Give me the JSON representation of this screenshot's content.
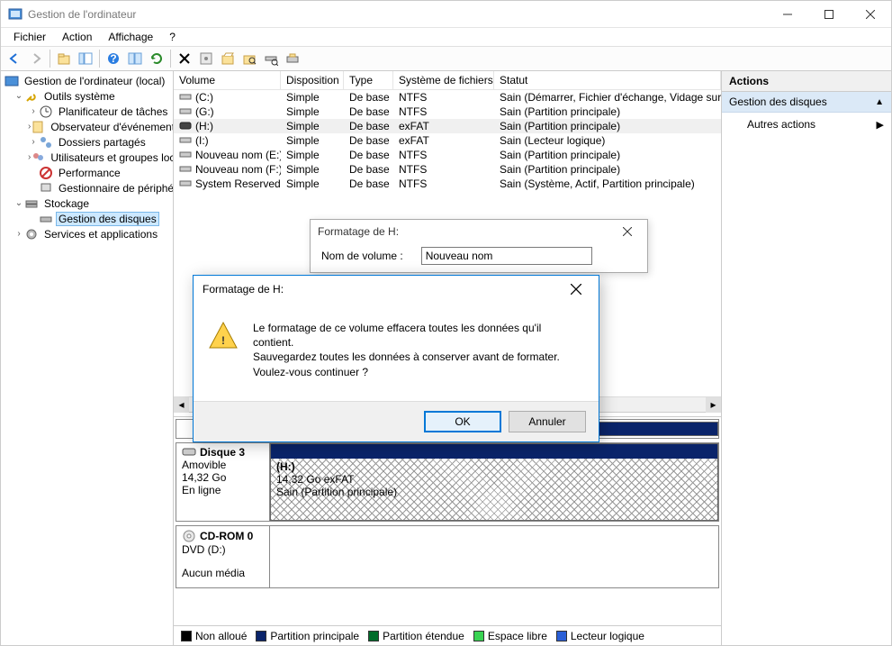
{
  "window": {
    "title": "Gestion de l'ordinateur"
  },
  "menu": {
    "file": "Fichier",
    "action": "Action",
    "view": "Affichage",
    "help": "?"
  },
  "tree": {
    "root": "Gestion de l'ordinateur (local)",
    "system_tools": "Outils système",
    "task_scheduler": "Planificateur de tâches",
    "event_viewer": "Observateur d'événements",
    "shared_folders": "Dossiers partagés",
    "users_groups": "Utilisateurs et groupes locaux",
    "performance": "Performance",
    "device_manager": "Gestionnaire de périphériques",
    "storage": "Stockage",
    "disk_management": "Gestion des disques",
    "services_apps": "Services et applications"
  },
  "columns": {
    "volume": "Volume",
    "layout": "Disposition",
    "type": "Type",
    "fs": "Système de fichiers",
    "status": "Statut"
  },
  "volumes": [
    {
      "name": "(C:)",
      "layout": "Simple",
      "type": "De base",
      "fs": "NTFS",
      "status": "Sain (Démarrer, Fichier d'échange, Vidage sur incident)"
    },
    {
      "name": "(G:)",
      "layout": "Simple",
      "type": "De base",
      "fs": "NTFS",
      "status": "Sain (Partition principale)"
    },
    {
      "name": "(H:)",
      "layout": "Simple",
      "type": "De base",
      "fs": "exFAT",
      "status": "Sain (Partition principale)",
      "selected": true,
      "removable": true
    },
    {
      "name": "(I:)",
      "layout": "Simple",
      "type": "De base",
      "fs": "exFAT",
      "status": "Sain (Lecteur logique)"
    },
    {
      "name": "Nouveau nom (E:)",
      "layout": "Simple",
      "type": "De base",
      "fs": "NTFS",
      "status": "Sain (Partition principale)"
    },
    {
      "name": "Nouveau nom (F:)",
      "layout": "Simple",
      "type": "De base",
      "fs": "NTFS",
      "status": "Sain (Partition principale)"
    },
    {
      "name": "System Reserved",
      "layout": "Simple",
      "type": "De base",
      "fs": "NTFS",
      "status": "Sain (Système, Actif, Partition principale)"
    }
  ],
  "disk3": {
    "name": "Disque 3",
    "type": "Amovible",
    "size": "14,32 Go",
    "state": "En ligne",
    "part_label": "(H:)",
    "part_size_fs": "14,32 Go exFAT",
    "part_status": "Sain (Partition principale)"
  },
  "cdrom": {
    "name": "CD-ROM 0",
    "type": "DVD (D:)",
    "state": "Aucun média"
  },
  "legend": {
    "unallocated": "Non alloué",
    "primary": "Partition principale",
    "extended": "Partition étendue",
    "free": "Espace libre",
    "logical": "Lecteur logique"
  },
  "actions_pane": {
    "header": "Actions",
    "section": "Gestion des disques",
    "more_actions": "Autres actions"
  },
  "format_dialog": {
    "title": "Formatage de H:",
    "label": "Nom de volume :",
    "value": "Nouveau nom"
  },
  "warning_dialog": {
    "title": "Formatage de H:",
    "line1": "Le formatage de ce volume effacera toutes les données qu'il contient.",
    "line2": "Sauvegardez toutes les données à conserver avant de formater.",
    "line3": "Voulez-vous continuer ?",
    "ok": "OK",
    "cancel": "Annuler"
  }
}
